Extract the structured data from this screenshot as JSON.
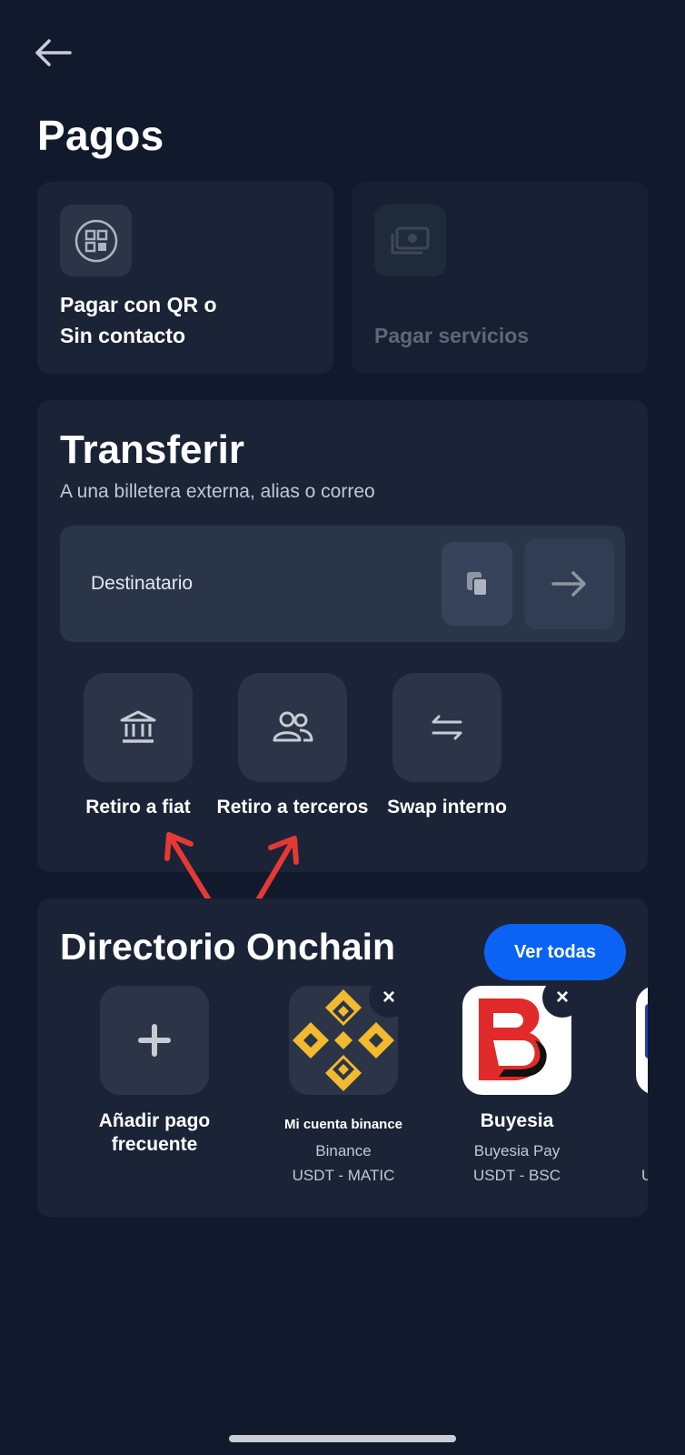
{
  "page": {
    "title": "Pagos"
  },
  "quick": {
    "qr_label_line1": "Pagar con QR o",
    "qr_label_line2": "Sin contacto",
    "services_label": "Pagar servicios"
  },
  "transfer": {
    "title": "Transferir",
    "subtitle": "A una billetera externa, alias o correo",
    "recipient_placeholder": "Destinatario",
    "actions": [
      {
        "label": "Retiro a fiat",
        "icon": "bank-icon"
      },
      {
        "label": "Retiro a terceros",
        "icon": "users-icon"
      },
      {
        "label": "Swap interno",
        "icon": "swap-icon"
      }
    ]
  },
  "directory": {
    "title": "Directorio Onchain",
    "view_all": "Ver todas",
    "add_label_line1": "Añadir pago",
    "add_label_line2": "frecuente",
    "contacts": [
      {
        "name": "Mi cuenta binance",
        "provider": "Binance",
        "network": "USDT - MATIC",
        "logo": "binance-logo",
        "color": "#f3ba2f"
      },
      {
        "name": "Buyesia",
        "provider": "Buyesia Pay",
        "network": "USDT - BSC",
        "logo": "buyesia-logo",
        "color": "#e12a2a"
      }
    ],
    "partial_contact_network": "U"
  },
  "annotations": {
    "arrow_color": "#e53935"
  }
}
